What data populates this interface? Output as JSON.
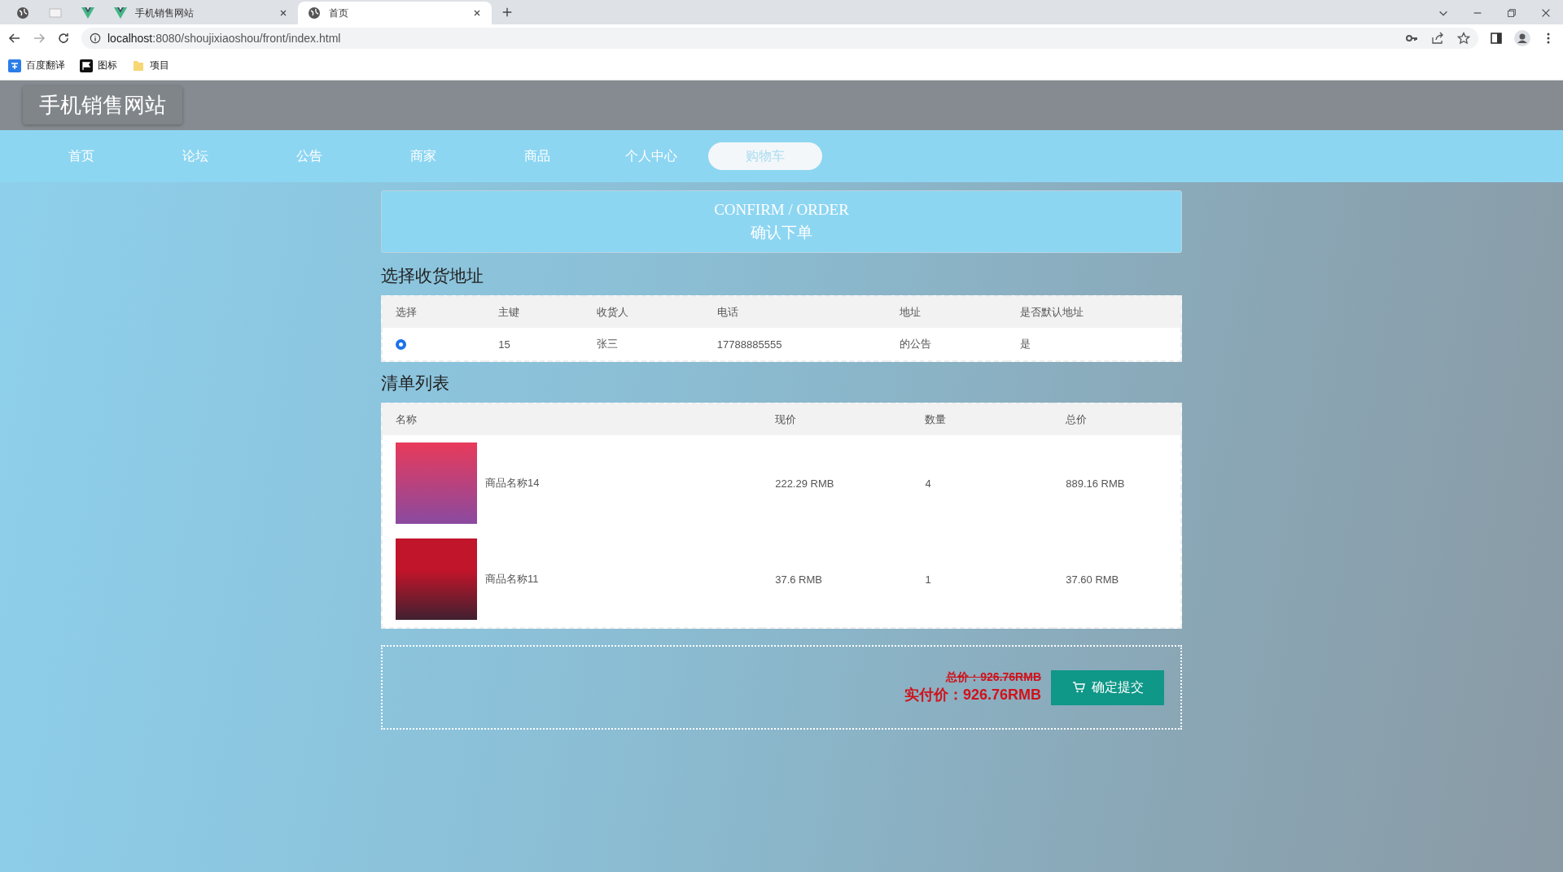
{
  "browser": {
    "tabs": [
      {
        "kind": "globe",
        "selected": false
      },
      {
        "kind": "blank",
        "selected": false
      },
      {
        "kind": "vue",
        "selected": false
      },
      {
        "kind": "vue",
        "label": "手机销售网站",
        "selected": false
      },
      {
        "kind": "globe",
        "label": "首页",
        "selected": true
      }
    ],
    "url_host": "localhost",
    "url_rest": ":8080/shoujixiaoshou/front/index.html",
    "bookmarks": [
      {
        "kind": "translate",
        "label": "百度翻译"
      },
      {
        "kind": "flag",
        "label": "图标"
      },
      {
        "kind": "folder",
        "label": "项目"
      }
    ]
  },
  "site_title": "手机销售网站",
  "nav": [
    {
      "label": "首页",
      "selected": false
    },
    {
      "label": "论坛",
      "selected": false
    },
    {
      "label": "公告",
      "selected": false
    },
    {
      "label": "商家",
      "selected": false
    },
    {
      "label": "商品",
      "selected": false
    },
    {
      "label": "个人中心",
      "selected": false
    },
    {
      "label": "购物车",
      "selected": true
    }
  ],
  "banner": {
    "title_en": "CONFIRM / ORDER",
    "title_cn": "确认下单"
  },
  "address_section": {
    "heading": "选择收货地址",
    "columns": [
      "选择",
      "主键",
      "收货人",
      "电话",
      "地址",
      "是否默认地址"
    ],
    "rows": [
      {
        "selected": true,
        "id": "15",
        "receiver": "张三",
        "phone": "17788885555",
        "address": "的公告",
        "default": "是"
      }
    ]
  },
  "list_section": {
    "heading": "清单列表",
    "columns": [
      "名称",
      "现价",
      "数量",
      "总价"
    ],
    "rows": [
      {
        "name": "商品名称14",
        "price": "222.29 RMB",
        "qty": "4",
        "total": "889.16 RMB"
      },
      {
        "name": "商品名称11",
        "price": "37.6 RMB",
        "qty": "1",
        "total": "37.60 RMB"
      }
    ]
  },
  "summary": {
    "total": "总价：926.76RMB",
    "paid": "实付价：926.76RMB",
    "submit": "确定提交"
  }
}
